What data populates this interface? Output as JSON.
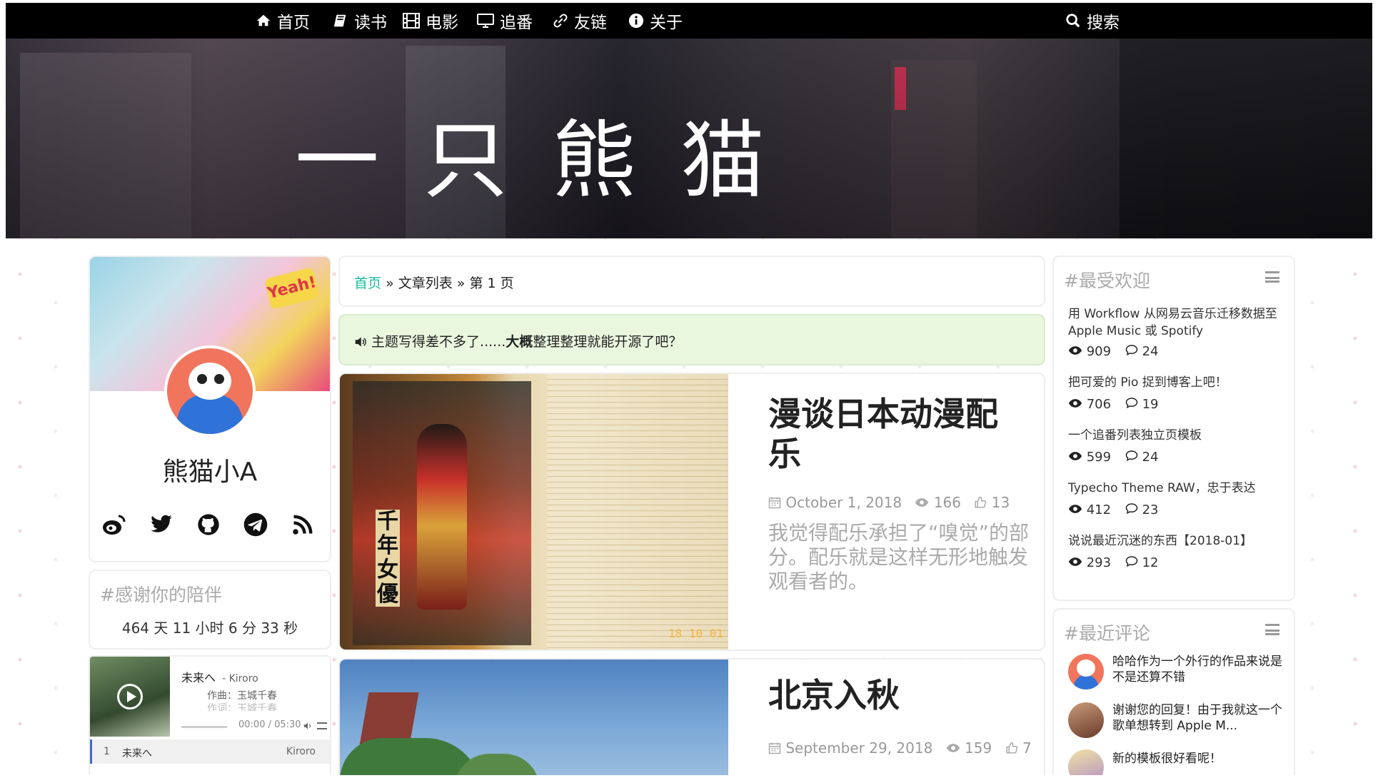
{
  "nav": {
    "items": [
      "首页",
      "读书",
      "电影",
      "追番",
      "友链",
      "关于"
    ],
    "search": "搜索"
  },
  "site": {
    "title": "一只熊猫"
  },
  "profile": {
    "name": "熊猫小A",
    "banner_text": "Yeah!"
  },
  "thanks": {
    "title": "#感谢你的陪伴",
    "uptime": "464 天 11 小时 6 分 33 秒"
  },
  "player": {
    "song": "未来へ",
    "artist": "- Kiroro",
    "composer": "作曲：玉城千春",
    "lyricist": "作词：玉城千春",
    "time": "00:00 / 05:30",
    "playlist": [
      {
        "index": "1",
        "title": "未来へ",
        "artist": "Kiroro"
      }
    ]
  },
  "breadcrumb": {
    "home": "首页",
    "sep1": "»",
    "list": "文章列表",
    "sep2": "»",
    "page": "第 1 页"
  },
  "notice": {
    "before": "主题写得差不多了......",
    "bold": "大概",
    "after": "整理整理就能开源了吧？"
  },
  "posts": [
    {
      "title": "漫谈日本动漫配乐",
      "date": "October 1, 2018",
      "views": "166",
      "likes": "13",
      "excerpt": "我觉得配乐承担了“嗅觉”的部分。配乐就是这样无形地触发观看者的。",
      "image_text": "千年女優",
      "image_stamp": "18 10 01"
    },
    {
      "title": "北京入秋",
      "date": "September 29, 2018",
      "views": "159",
      "likes": "7"
    }
  ],
  "popular": {
    "title": "#最受欢迎",
    "items": [
      {
        "title": "用 Workflow 从网易云音乐迁移数据至 Apple Music 或 Spotify",
        "views": "909",
        "comments": "24"
      },
      {
        "title": "把可爱的 Pio 捉到博客上吧！",
        "views": "706",
        "comments": "19"
      },
      {
        "title": "一个追番列表独立页模板",
        "views": "599",
        "comments": "24"
      },
      {
        "title": "Typecho Theme RAW，忠于表达",
        "views": "412",
        "comments": "23"
      },
      {
        "title": "说说最近沉迷的东西【2018-01】",
        "views": "293",
        "comments": "12"
      }
    ]
  },
  "recent_comments": {
    "title": "#最近评论",
    "items": [
      {
        "text": "哈哈作为一个外行的作品来说是不是还算不错"
      },
      {
        "text": "谢谢您的回复！由于我就这一个歌单想转到 Apple M..."
      },
      {
        "text": "新的模板很好看呢！"
      }
    ]
  },
  "colors": {
    "nav_bg": "#000000",
    "accent": "#1abc9c",
    "notice_bg": "#e9f7df"
  }
}
